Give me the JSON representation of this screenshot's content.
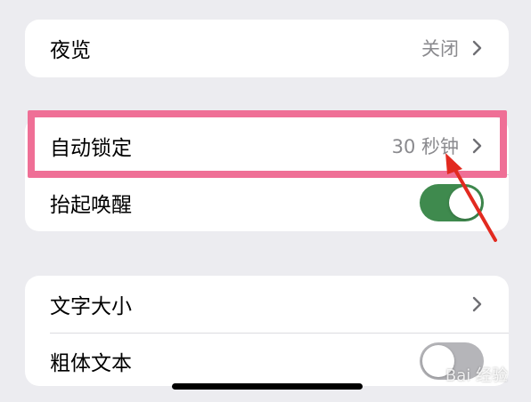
{
  "settings": {
    "night_shift": {
      "label": "夜览",
      "value": "关闭"
    },
    "auto_lock": {
      "label": "自动锁定",
      "value": "30 秒钟"
    },
    "raise_to_wake": {
      "label": "抬起唤醒",
      "enabled": true
    },
    "text_size": {
      "label": "文字大小"
    },
    "bold_text": {
      "label": "粗体文本",
      "enabled": false
    }
  },
  "watermark": "Bai 经验",
  "colors": {
    "background": "#ececf0",
    "toggle_on": "#3f8a4e",
    "highlight": "#ef6f96",
    "arrow": "#e22a20"
  }
}
